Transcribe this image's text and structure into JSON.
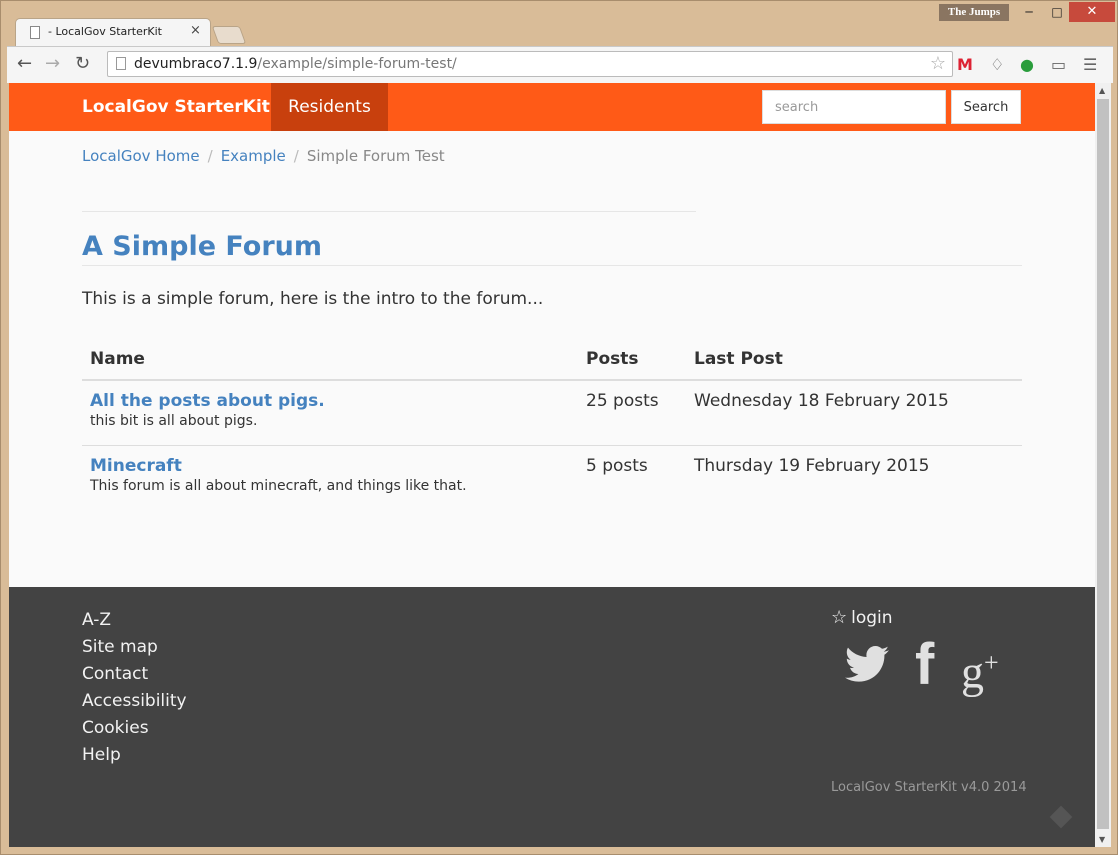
{
  "browser": {
    "tab_title": "- LocalGov StarterKit",
    "tab_close": "×",
    "profile_name": "The Jumps",
    "url_host": "devumbraco7.1.9",
    "url_path": "/example/simple-forum-test/",
    "icons": [
      "back-icon",
      "forward-icon",
      "reload-icon",
      "page-icon",
      "bookmark-star-icon",
      "gmail-icon",
      "notifications-bell-icon",
      "hangouts-icon",
      "cast-icon",
      "menu-icon"
    ]
  },
  "navbar": {
    "brand": "LocalGov StarterKit",
    "active_item": "Residents",
    "search_placeholder": "search",
    "search_button": "Search",
    "color": "#ff5a17",
    "active_color": "#c8400d"
  },
  "breadcrumb": {
    "items": [
      "LocalGov Home",
      "Example"
    ],
    "current": "Simple Forum Test",
    "separator": "/"
  },
  "main": {
    "title": "A Simple Forum",
    "intro": "This is a simple forum, here is the intro to the forum..."
  },
  "forum_table": {
    "headers": [
      "Name",
      "Posts",
      "Last Post"
    ],
    "rows": [
      {
        "name": "All the posts about pigs.",
        "description": "this bit is all about pigs.",
        "posts": "25 posts",
        "last_post": "Wednesday 18 February 2015"
      },
      {
        "name": "Minecraft",
        "description": "This forum is all about minecraft, and things like that.",
        "posts": "5 posts",
        "last_post": "Thursday 19 February 2015"
      }
    ]
  },
  "footer": {
    "links": [
      "A-Z",
      "Site map",
      "Contact",
      "Accessibility",
      "Cookies",
      "Help"
    ],
    "login_label": "login",
    "social_icons": [
      "twitter-icon",
      "facebook-icon",
      "google-plus-icon"
    ],
    "version": "LocalGov StarterKit v4.0 2014",
    "color": "#434343"
  }
}
